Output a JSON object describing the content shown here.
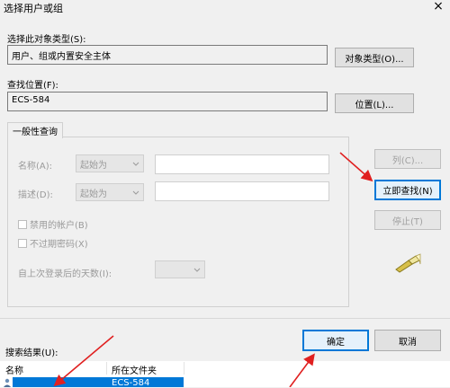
{
  "dialog": {
    "title": "选择用户或组"
  },
  "object_type": {
    "label": "选择此对象类型(S):",
    "value": "用户、组或内置安全主体",
    "button": "对象类型(O)..."
  },
  "location": {
    "label": "查找位置(F):",
    "value": "ECS-584",
    "button": "位置(L)..."
  },
  "query": {
    "tab": "一般性查询",
    "name_label": "名称(A):",
    "name_mode": "起始为",
    "desc_label": "描述(D):",
    "desc_mode": "起始为",
    "disabled_accounts": "禁用的帐户(B)",
    "non_expiring_pw": "不过期密码(X)",
    "days_since_login": "自上次登录后的天数(I):"
  },
  "side_buttons": {
    "columns": "列(C)...",
    "find_now": "立即查找(N)",
    "stop": "停止(T)"
  },
  "actions": {
    "ok": "确定",
    "cancel": "取消"
  },
  "results": {
    "label": "搜索结果(U):",
    "columns": [
      "名称",
      "所在文件夹"
    ],
    "rows": [
      {
        "name": "",
        "folder": "ECS-584"
      }
    ]
  },
  "colors": {
    "accent": "#0078d7",
    "annotation_arrow": "#e02020"
  },
  "icons": {
    "search_icon": "flashlight-search-icon",
    "user_icon": "user-icon"
  }
}
